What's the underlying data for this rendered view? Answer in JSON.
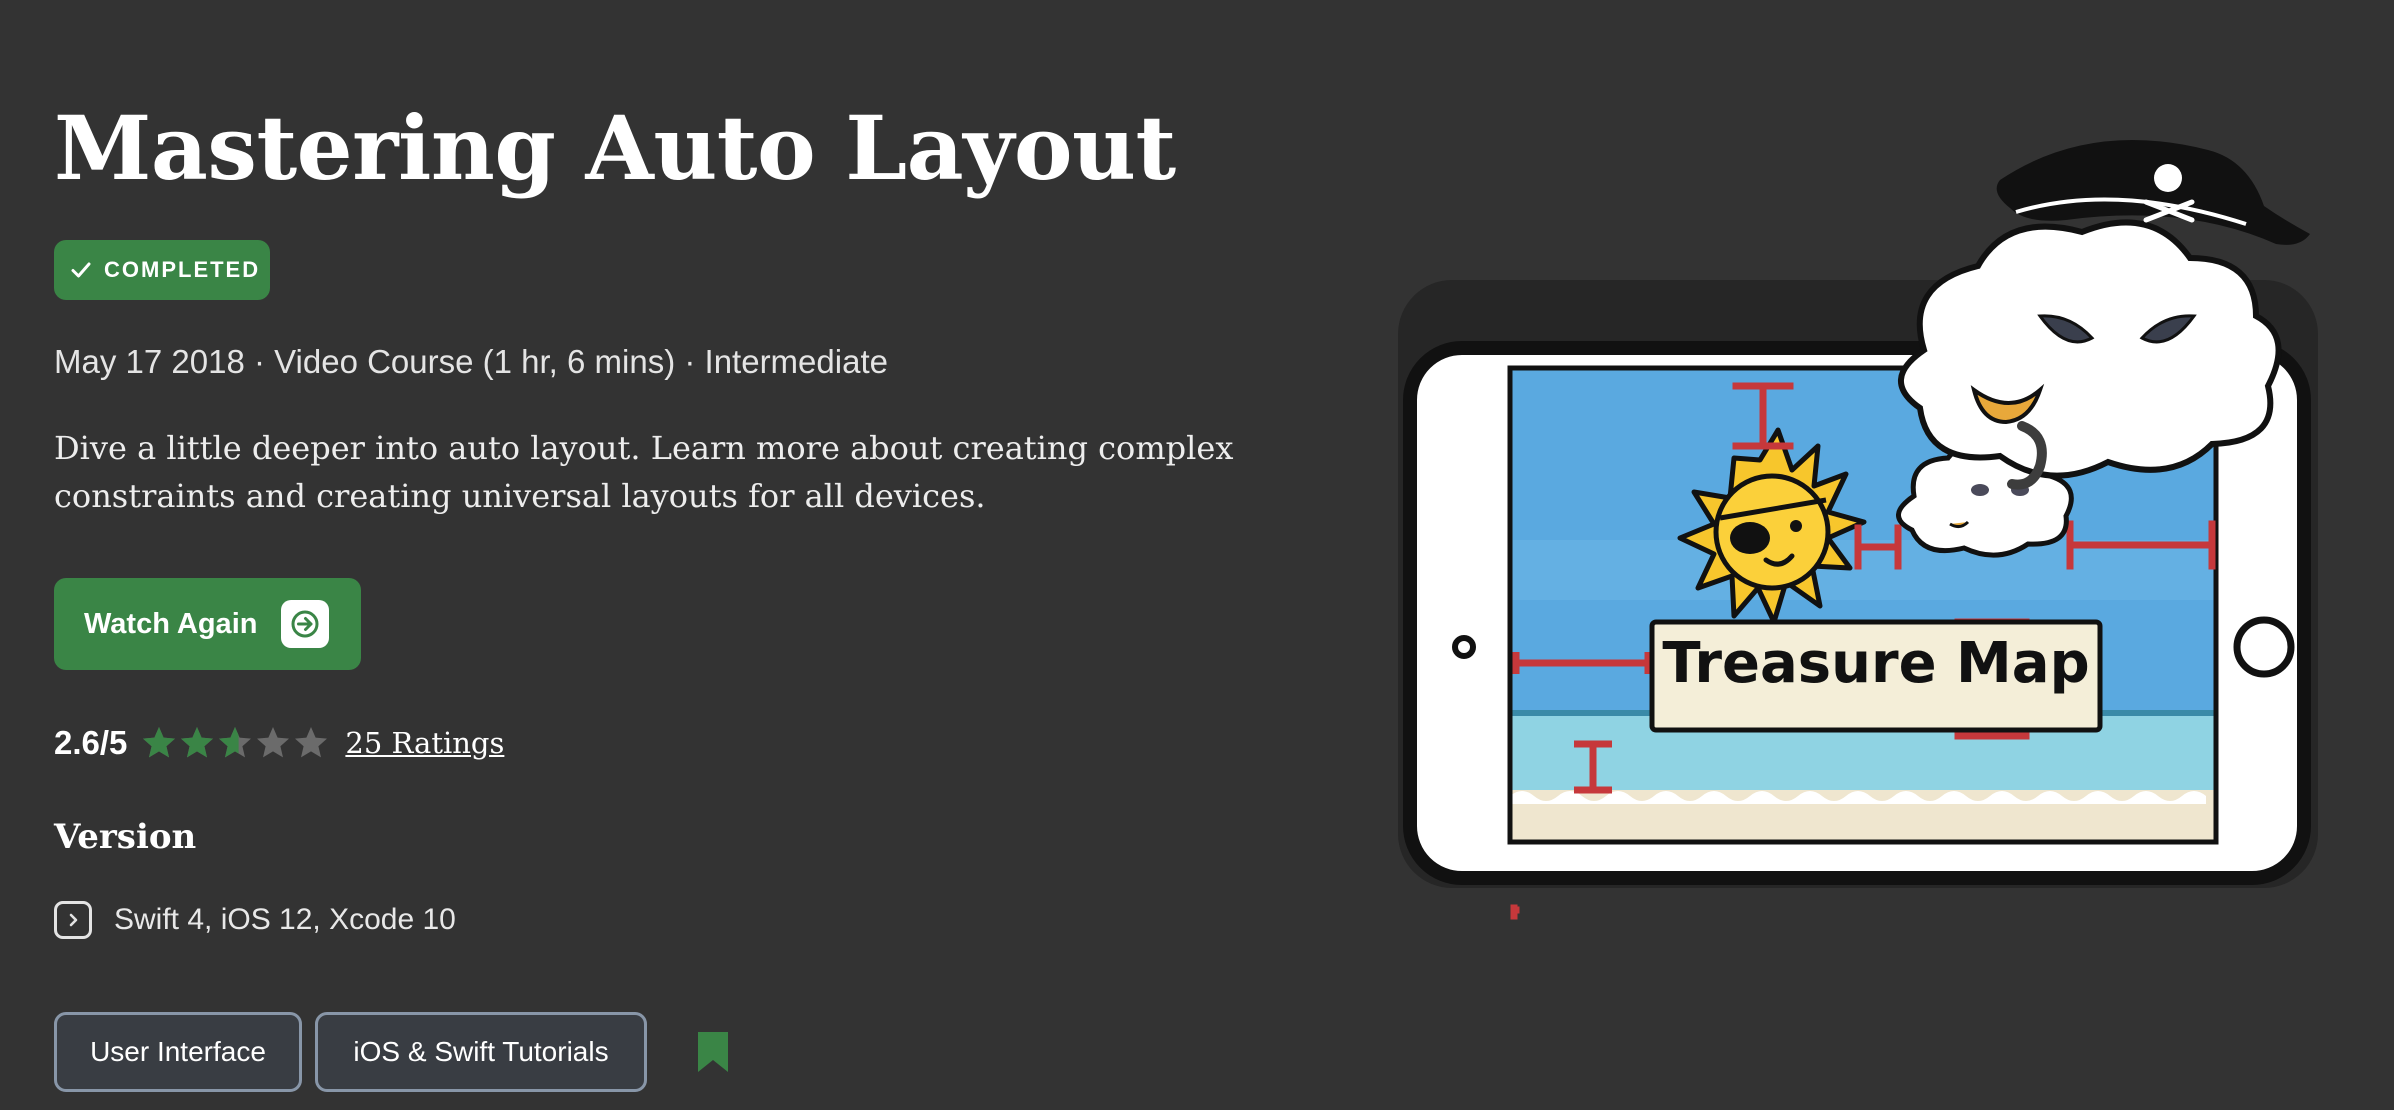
{
  "course": {
    "title": "Mastering Auto Layout",
    "badge": "COMPLETED",
    "meta": "May 17 2018 · Video Course (1 hr, 6 mins) · Intermediate",
    "description": "Dive a little deeper into auto layout. Learn more about creating complex constraints and creating universal layouts for all devices."
  },
  "watch_button": {
    "label": "Watch Again",
    "icon": "arrow-right-icon"
  },
  "rating": {
    "score_text": "2.6/5",
    "value": 2.6,
    "max": 5,
    "link_text": "25 Ratings"
  },
  "version": {
    "heading": "Version",
    "icon": "chevron-right-icon",
    "text": "Swift 4, iOS 12, Xcode 10"
  },
  "tags": [
    "User Interface",
    "iOS & Swift Tutorials"
  ],
  "bookmark_icon": "bookmark-icon",
  "artwork": {
    "sign_text": "Treasure Map"
  },
  "colors": {
    "background": "#333333",
    "accent_green": "#3a8546",
    "tag_border": "#8896a8"
  }
}
